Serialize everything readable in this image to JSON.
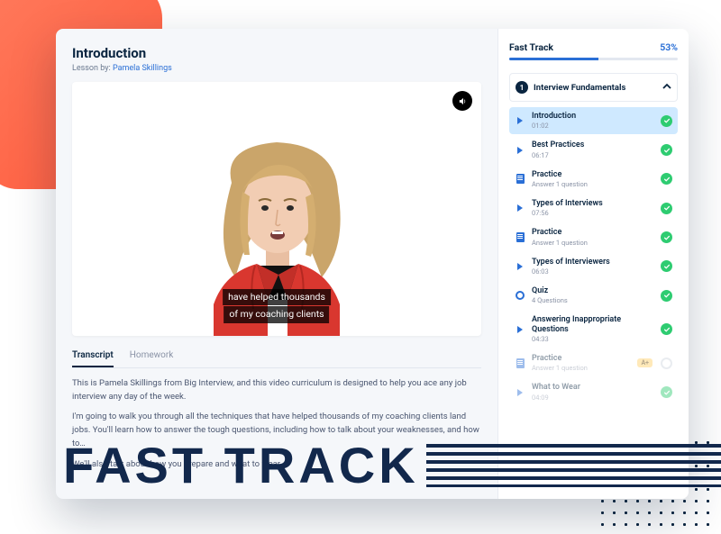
{
  "main": {
    "title": "Introduction",
    "by_label": "Lesson by:",
    "author": "Pamela Skillings",
    "caption_line1": "have helped thousands",
    "caption_line2": "of my coaching clients",
    "tabs": {
      "transcript": "Transcript",
      "homework": "Homework"
    },
    "transcript": {
      "p1": "This is Pamela Skillings from Big Interview, and this video curriculum is designed to help you ace any job interview any day of the week.",
      "p2": "I'm going to walk you through all the techniques that have helped thousands of my coaching clients land jobs. You'll learn how to answer the tough questions, including how to talk about your weaknesses, and how to…",
      "p3": "We'll also talk about how you prepare and what to wear."
    }
  },
  "sidebar": {
    "course": "Fast Track",
    "progress_pct": "53%",
    "progress_value": 53,
    "section": {
      "num": "1",
      "title": "Interview Fundamentals"
    },
    "items": [
      {
        "name": "Introduction",
        "meta": "01:02",
        "type": "play",
        "active": true,
        "done": true
      },
      {
        "name": "Best Practices",
        "meta": "06:17",
        "type": "play",
        "done": true
      },
      {
        "name": "Practice",
        "meta": "Answer 1 question",
        "type": "doc",
        "done": true
      },
      {
        "name": "Types of Interviews",
        "meta": "07:56",
        "type": "play",
        "done": true
      },
      {
        "name": "Practice",
        "meta": "Answer 1 question",
        "type": "doc",
        "done": true
      },
      {
        "name": "Types of Interviewers",
        "meta": "06:03",
        "type": "play",
        "done": true
      },
      {
        "name": "Quiz",
        "meta": "4 Questions",
        "type": "quiz",
        "done": true
      },
      {
        "name": "Answering Inappropriate Questions",
        "meta": "04:33",
        "type": "play",
        "done": true
      },
      {
        "name": "Practice",
        "meta": "Answer 1 question",
        "type": "doc",
        "badge": "A+",
        "dim": true,
        "ring": true
      },
      {
        "name": "What to Wear",
        "meta": "04:09",
        "type": "play",
        "dim": true,
        "done": true
      }
    ]
  },
  "overlay": {
    "text": "FAST TRACK"
  },
  "colors": {
    "accent": "#2a6fd6",
    "dark": "#0a2540",
    "success": "#2ecc71"
  }
}
